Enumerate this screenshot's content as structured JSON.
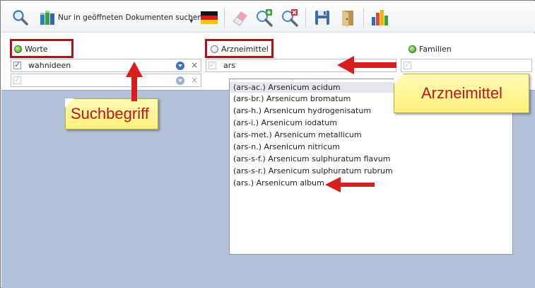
{
  "toolbar": {
    "search_label": "Nur in geöffneten Dokumenten suchen"
  },
  "columns": {
    "worte": "Worte",
    "arzneimittel": "Arzneimittel",
    "familien": "Familien"
  },
  "worte_rows": [
    {
      "value": "wahnideen",
      "checked": true
    },
    {
      "value": "",
      "checked": false
    }
  ],
  "arzneimittel_input": "ars",
  "dropdown_items": [
    "(ars-ac.) Arsenicum acidum",
    "(ars-br.) Arsenicum bromatum",
    "(ars-h.) Arsenicum hydrogenisatum",
    "(ars-i.) Arsenicum iodatum",
    "(ars-met.) Arsenicum metallicum",
    "(ars-n.) Arsenicum nitricum",
    "(ars-s-f.) Arsenicum sulphuratum flavum",
    "(ars-s-r.) Arsenicum sulphuratum rubrum",
    "(ars.) Arsenicum album"
  ],
  "callouts": {
    "suchbegriff": "Suchbegriff",
    "arzneimittel": "Arzneimittel"
  },
  "colors": {
    "annotation_red": "#c0151b",
    "callout_yellow": "#fff07a",
    "panel_blue": "#b3c1d9"
  }
}
